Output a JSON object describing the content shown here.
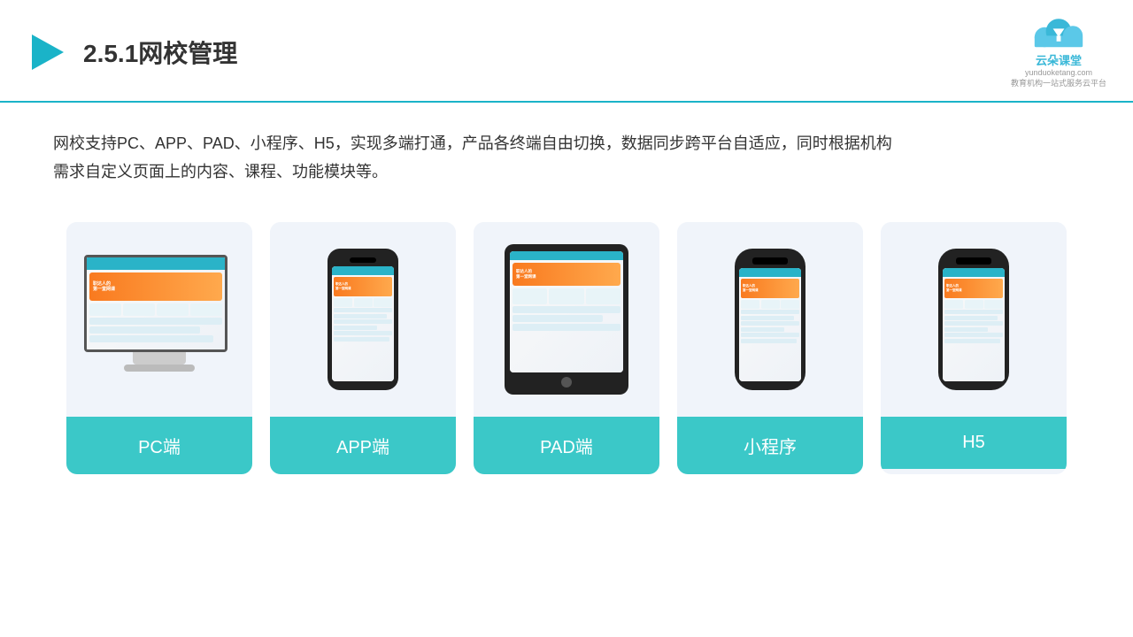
{
  "header": {
    "title": "2.5.1网校管理",
    "logo_url": "yunduoketang",
    "logo_subtitle": "yunduoketang.com",
    "logo_tagline": "教育机构一站\n式服务云平台"
  },
  "description": {
    "text": "网校支持PC、APP、PAD、小程序、H5，实现多端打通，产品各终端自由切换，数据同步跨平台自适应，同时根据机构需求自定义页面上的内容、课程、功能模块等。"
  },
  "cards": [
    {
      "id": "pc",
      "label": "PC端"
    },
    {
      "id": "app",
      "label": "APP端"
    },
    {
      "id": "pad",
      "label": "PAD端"
    },
    {
      "id": "miniapp",
      "label": "小程序"
    },
    {
      "id": "h5",
      "label": "H5"
    }
  ],
  "colors": {
    "accent": "#3bc8c8",
    "header_line": "#1ab3c8"
  }
}
